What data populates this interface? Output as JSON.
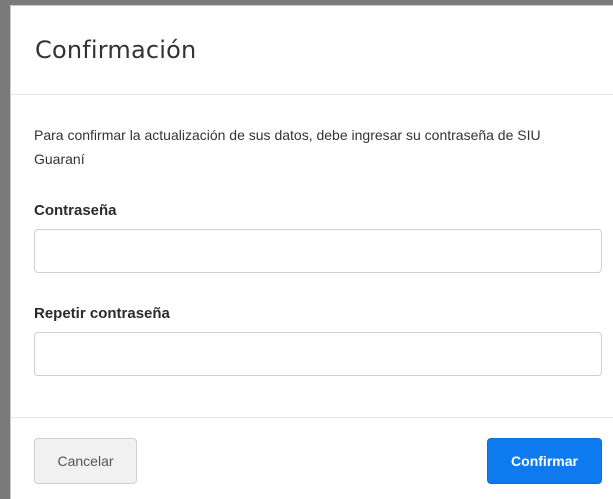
{
  "modal": {
    "title": "Confirmación",
    "intro": "Para confirmar la actualización de sus datos, debe ingresar su contraseña de SIU Guaraní",
    "password_label": "Contraseña",
    "password_value": "",
    "repeat_password_label": "Repetir contraseña",
    "repeat_password_value": "",
    "cancel_label": "Cancelar",
    "confirm_label": "Confirmar"
  },
  "colors": {
    "accent": "#0d7bef",
    "text": "#333333",
    "border": "#cfcfcf",
    "cancel_bg": "#f1f1f1"
  }
}
